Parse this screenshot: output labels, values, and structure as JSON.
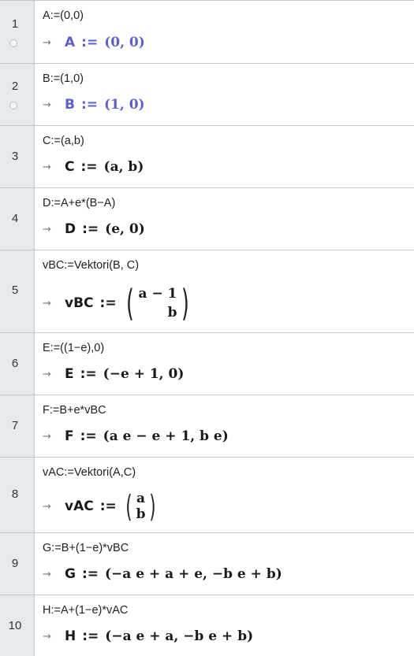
{
  "rows": [
    {
      "num": "1",
      "input": "A:=(0,0)",
      "arrow": "→",
      "name": "A",
      "assign": ":=",
      "value": "(0,  0)",
      "blue": true,
      "toggle": true
    },
    {
      "num": "2",
      "input": "B:=(1,0)",
      "arrow": "→",
      "name": "B",
      "assign": ":=",
      "value": "(1,  0)",
      "blue": true,
      "toggle": true
    },
    {
      "num": "3",
      "input": "C:=(a,b)",
      "arrow": "→",
      "name": "C",
      "assign": ":=",
      "value": "(a,  b)"
    },
    {
      "num": "4",
      "input": "D:=A+e*(B−A)",
      "arrow": "→",
      "name": "D",
      "assign": ":=",
      "value": "(e,  0)"
    },
    {
      "num": "5",
      "input": "vBC:=Vektori(B, C)",
      "arrow": "→",
      "name": "vBC",
      "assign": ":=",
      "vector": [
        "a − 1",
        "b"
      ]
    },
    {
      "num": "6",
      "input": "E:=((1−e),0)",
      "arrow": "→",
      "name": "E",
      "assign": ":=",
      "value": "(−e + 1,  0)"
    },
    {
      "num": "7",
      "input": "F:=B+e*vBC",
      "arrow": "→",
      "name": "F",
      "assign": ":=",
      "value": "(a e − e + 1,  b e)"
    },
    {
      "num": "8",
      "input": "vAC:=Vektori(A,C)",
      "arrow": "→",
      "name": "vAC",
      "assign": ":=",
      "vector": [
        "a",
        "b"
      ]
    },
    {
      "num": "9",
      "input": "G:=B+(1−e)*vBC",
      "arrow": "→",
      "name": "G",
      "assign": ":=",
      "value": "(−a e + a + e,  −b e + b)"
    },
    {
      "num": "10",
      "input": "H:=A+(1−e)*vAC",
      "arrow": "→",
      "name": "H",
      "assign": ":=",
      "value": "(−a e + a,  −b e + b)"
    }
  ]
}
